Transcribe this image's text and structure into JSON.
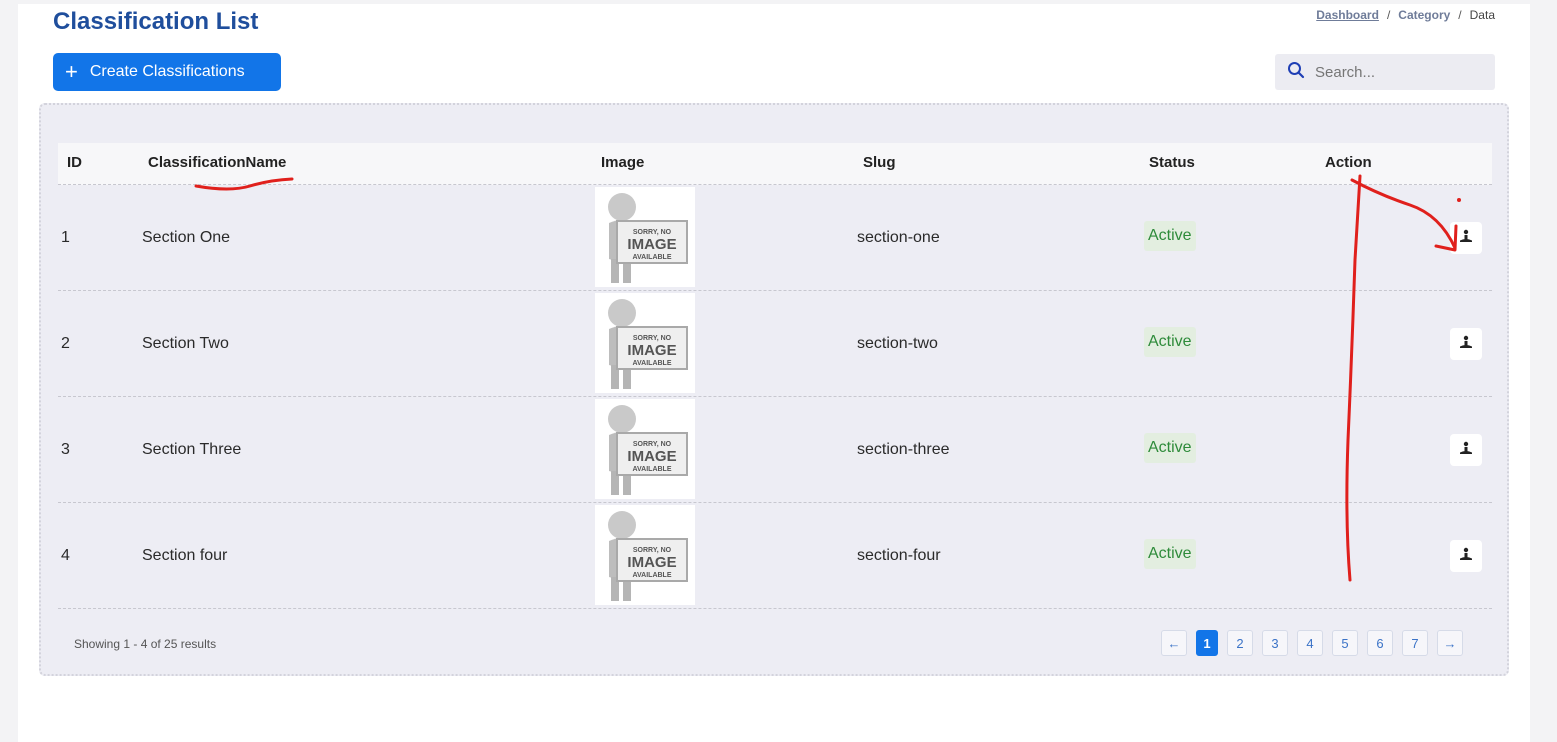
{
  "page": {
    "title": "Classification List"
  },
  "breadcrumb": [
    {
      "label": "Dashboard"
    },
    {
      "label": "Category"
    },
    {
      "label": "Data"
    }
  ],
  "breadcrumb_sep": "/",
  "create_button": {
    "label": "Create Classifications",
    "icon": "plus-icon"
  },
  "search": {
    "placeholder": "Search...",
    "icon": "search-icon"
  },
  "table": {
    "columns": [
      "ID",
      "ClassificationName",
      "Image",
      "Slug",
      "Status",
      "Action"
    ],
    "rows": [
      {
        "id": "1",
        "name": "Section One",
        "slug": "section-one",
        "status": "Active"
      },
      {
        "id": "2",
        "name": "Section Two",
        "slug": "section-two",
        "status": "Active"
      },
      {
        "id": "3",
        "name": "Section Three",
        "slug": "section-three",
        "status": "Active"
      },
      {
        "id": "4",
        "name": "Section four",
        "slug": "section-four",
        "status": "Active"
      }
    ],
    "placeholder_image": {
      "line1": "SORRY, NO",
      "line2": "IMAGE",
      "line3": "AVAILABLE"
    },
    "action_icon": "user-icon"
  },
  "footer": {
    "showing": "Showing 1 - 4 of 25 results"
  },
  "pagination": {
    "prev_icon": "arrow-left-icon",
    "next_icon": "arrow-right-icon",
    "pages": [
      "1",
      "2",
      "3",
      "4",
      "5",
      "6",
      "7"
    ],
    "current": "1"
  },
  "colors": {
    "accent": "#1275e8",
    "title": "#1f4e9c",
    "status_text": "#2e8b3a",
    "annotation": "#e0201c"
  }
}
